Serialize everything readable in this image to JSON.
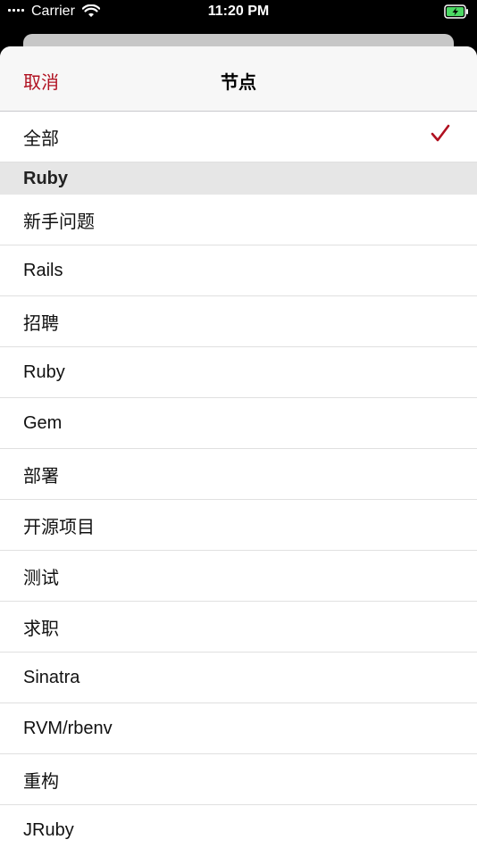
{
  "status_bar": {
    "carrier": "Carrier",
    "time": "11:20 PM",
    "wifi_icon": "wifi-icon",
    "battery_icon": "battery-charging-icon"
  },
  "nav": {
    "cancel_label": "取消",
    "title": "节点"
  },
  "all_option": {
    "label": "全部",
    "selected": true,
    "check_icon": "checkmark-icon",
    "accent_color": "#b01020"
  },
  "section": {
    "header": "Ruby",
    "items": [
      {
        "label": "新手问题"
      },
      {
        "label": "Rails"
      },
      {
        "label": "招聘"
      },
      {
        "label": "Ruby"
      },
      {
        "label": "Gem"
      },
      {
        "label": "部署"
      },
      {
        "label": "开源项目"
      },
      {
        "label": "测试"
      },
      {
        "label": "求职"
      },
      {
        "label": "Sinatra"
      },
      {
        "label": "RVM/rbenv"
      },
      {
        "label": "重构"
      },
      {
        "label": "JRuby"
      }
    ]
  }
}
